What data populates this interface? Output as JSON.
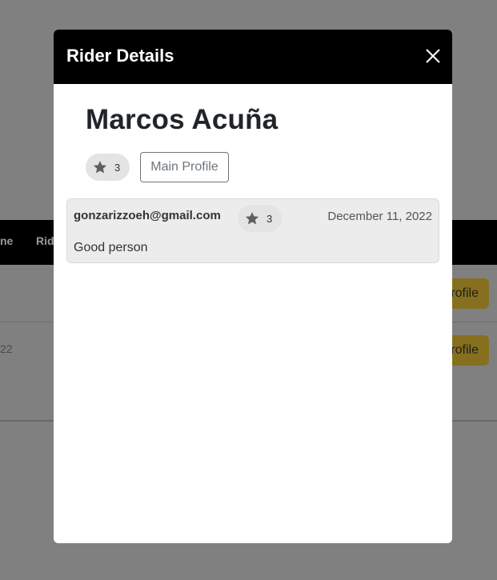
{
  "background": {
    "nav_items": [
      "ne",
      "Rid"
    ],
    "row_cell_text": "22",
    "profile_buttons": [
      "rofile",
      "rofile"
    ]
  },
  "modal": {
    "title": "Rider Details",
    "close_icon": "close-icon",
    "rider_name": "Marcos Acuña",
    "rating": "3",
    "star_icon": "star-icon",
    "main_profile_label": "Main Profile",
    "reviews": [
      {
        "email": "gonzarizzoeh@gmail.com",
        "rating": "3",
        "date": "December 11, 2022",
        "text": "Good person"
      }
    ]
  },
  "colors": {
    "overlay": "#808080",
    "modal_header": "#000000",
    "profile_button_dimmed": "#86701f",
    "review_card": "#ececec",
    "rating_pill": "#e4e4e4"
  }
}
